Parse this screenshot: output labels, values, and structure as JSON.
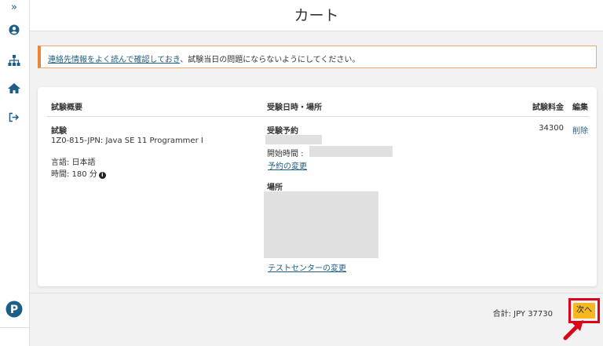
{
  "sidebar": {
    "expand_icon": "chevron-double-right-icon",
    "items": [
      "user-icon",
      "sitemap-icon",
      "home-icon",
      "logout-icon"
    ],
    "logo": "P"
  },
  "header": {
    "title": "カート"
  },
  "notice": {
    "link_text": "連絡先情報をよく読んで確認しておき",
    "text": "、試験当日の問題にならないようにしてください。"
  },
  "table": {
    "headers": {
      "summary": "試験概要",
      "datetime": "受験日時・場所",
      "fee": "試験料金",
      "edit": "編集"
    },
    "exam": {
      "label": "試験",
      "name": "1Z0-815-JPN: Java SE 11 Programmer I",
      "language": "言語: 日本語",
      "duration": "時間: 180 分",
      "info_icon": "i"
    },
    "reservation": {
      "label": "受験予約",
      "start_time_label": "開始時間 :",
      "change_link": "予約の変更",
      "location_label": "場所",
      "change_center_link": "テストセンターの変更"
    },
    "fee": "34300",
    "delete_link": "削除"
  },
  "footer": {
    "total": "合計: JPY 37730",
    "next_label": "次へ"
  },
  "colors": {
    "accent": "#1d5e88",
    "notice_border": "#e8873a",
    "next_button": "#f5b820",
    "highlight": "#d9061b"
  }
}
